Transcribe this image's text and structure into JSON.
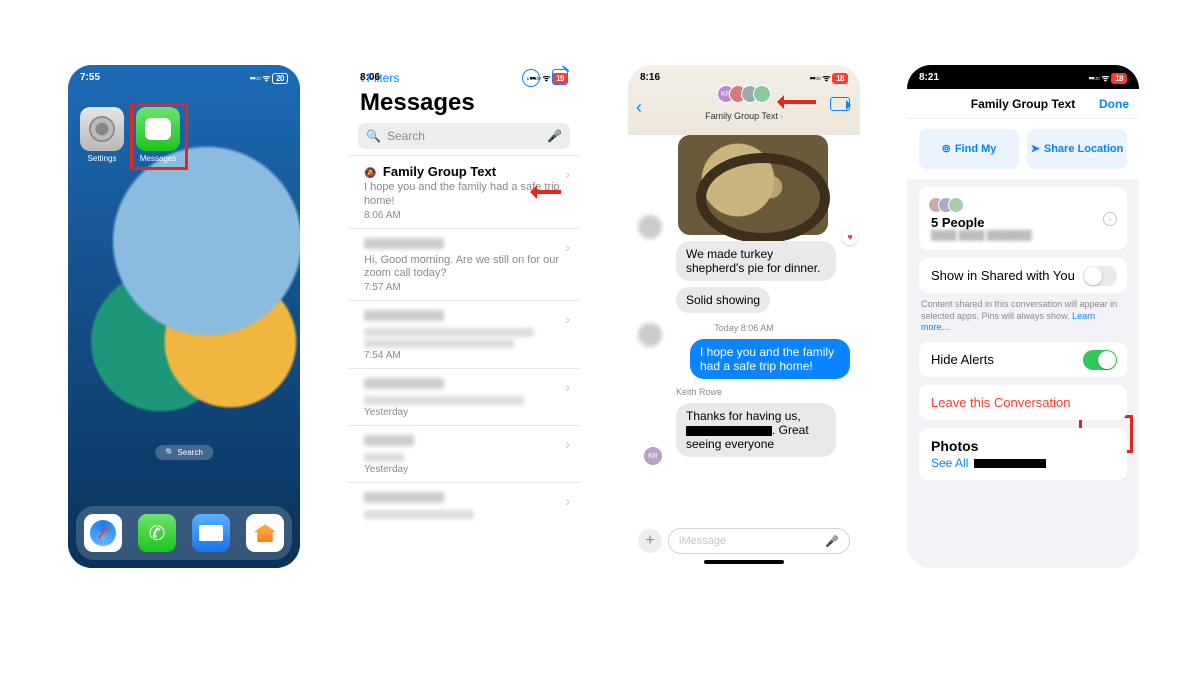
{
  "screen1": {
    "time": "7:55",
    "signal": "▪▪▫▫ ᯤ",
    "battery": "20",
    "apps": {
      "settings": "Settings",
      "messages": "Messages"
    },
    "spotlight": "🔍 Search",
    "dock": [
      "safari",
      "phone",
      "mail",
      "home"
    ]
  },
  "screen2": {
    "time": "8:06",
    "signal": "▪▪▫▫ ᯤ",
    "battery": "19",
    "filters": "Filters",
    "title": "Messages",
    "search_placeholder": "Search",
    "convos": [
      {
        "name": "Family Group Text",
        "preview": "I hope you and the family had a safe trip home!",
        "time": "8:06 AM",
        "mute": true
      },
      {
        "name_blur": true,
        "preview": "Hi, Good morning. Are we still on for our zoom call today?",
        "time": "7:57 AM"
      },
      {
        "name_blur": true,
        "preview_blur": true,
        "time": "7:54 AM"
      },
      {
        "name_blur": true,
        "preview_blur": true,
        "time": "Yesterday"
      },
      {
        "name_blur": true,
        "preview_blur": true,
        "time": "Yesterday"
      },
      {
        "name_blur": true,
        "preview_blur": true,
        "time": ""
      }
    ]
  },
  "screen3": {
    "time": "8:16",
    "signal": "▪▪▫▫ ᯤ",
    "battery": "18",
    "group_name": "Family Group Text",
    "avatar_initials": "KR",
    "msg_in1": "We made turkey shepherd's pie for dinner.",
    "msg_in2": "Solid showing",
    "timestamp": "Today 8:06 AM",
    "msg_out": "I hope you and the family had a safe trip home!",
    "sender": "Keith Rowe",
    "msg_in3a": "Thanks for having us,",
    "msg_in3b": ". Great seeing everyone",
    "input_placeholder": "iMessage"
  },
  "screen4": {
    "time": "8:21",
    "signal": "▪▪▫▫ ᯤ",
    "battery": "18",
    "title": "Family Group Text",
    "done": "Done",
    "findmy": "Find My",
    "share_loc": "Share Location",
    "people_count": "5 People",
    "shared_label": "Show in Shared with You",
    "shared_hint": "Content shared in this conversation will appear in selected apps. Pins will always show.",
    "learn_more": "Learn more…",
    "hide_alerts": "Hide Alerts",
    "hide_alerts_on": true,
    "leave": "Leave this Conversation",
    "photos": "Photos",
    "see_all": "See All"
  }
}
